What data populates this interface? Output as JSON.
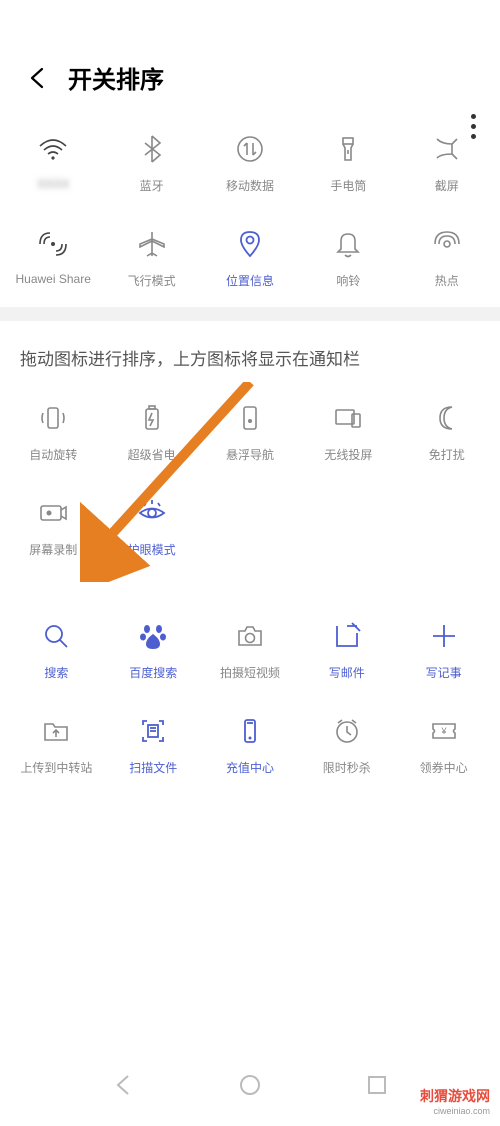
{
  "header": {
    "title": "开关排序"
  },
  "top_grid": [
    {
      "name": "wifi",
      "label": "XXXX",
      "blurred": true
    },
    {
      "name": "bluetooth",
      "label": "蓝牙"
    },
    {
      "name": "mobile-data",
      "label": "移动数据"
    },
    {
      "name": "flashlight",
      "label": "手电筒"
    },
    {
      "name": "screenshot",
      "label": "截屏"
    },
    {
      "name": "huawei-share",
      "label": "Huawei Share"
    },
    {
      "name": "airplane",
      "label": "飞行模式"
    },
    {
      "name": "location",
      "label": "位置信息",
      "highlight": true
    },
    {
      "name": "ring",
      "label": "响铃"
    },
    {
      "name": "hotspot",
      "label": "热点"
    }
  ],
  "instruction": "拖动图标进行排序，上方图标将显示在通知栏",
  "mid_grid": [
    {
      "name": "auto-rotate",
      "label": "自动旋转"
    },
    {
      "name": "power-save",
      "label": "超级省电"
    },
    {
      "name": "float-nav",
      "label": "悬浮导航"
    },
    {
      "name": "wireless-cast",
      "label": "无线投屏"
    },
    {
      "name": "dnd",
      "label": "免打扰"
    },
    {
      "name": "screen-record",
      "label": "屏幕录制"
    },
    {
      "name": "eye-care",
      "label": "护眼模式",
      "highlight": true
    }
  ],
  "shortcuts": [
    {
      "name": "search",
      "label": "搜索",
      "blue": true
    },
    {
      "name": "baidu",
      "label": "百度搜索",
      "blue": true
    },
    {
      "name": "shoot-video",
      "label": "拍摄短视频"
    },
    {
      "name": "compose-mail",
      "label": "写邮件",
      "blue": true
    },
    {
      "name": "compose-note",
      "label": "写记事",
      "blue": true
    },
    {
      "name": "upload-station",
      "label": "上传到中转站"
    },
    {
      "name": "scan-doc",
      "label": "扫描文件",
      "blue": true
    },
    {
      "name": "recharge",
      "label": "充值中心",
      "blue": true
    },
    {
      "name": "flash-sale",
      "label": "限时秒杀"
    },
    {
      "name": "coupon-center",
      "label": "领券中心"
    }
  ],
  "watermark": {
    "logo": "刺猬游戏网",
    "url": "ciweiniao.com"
  }
}
